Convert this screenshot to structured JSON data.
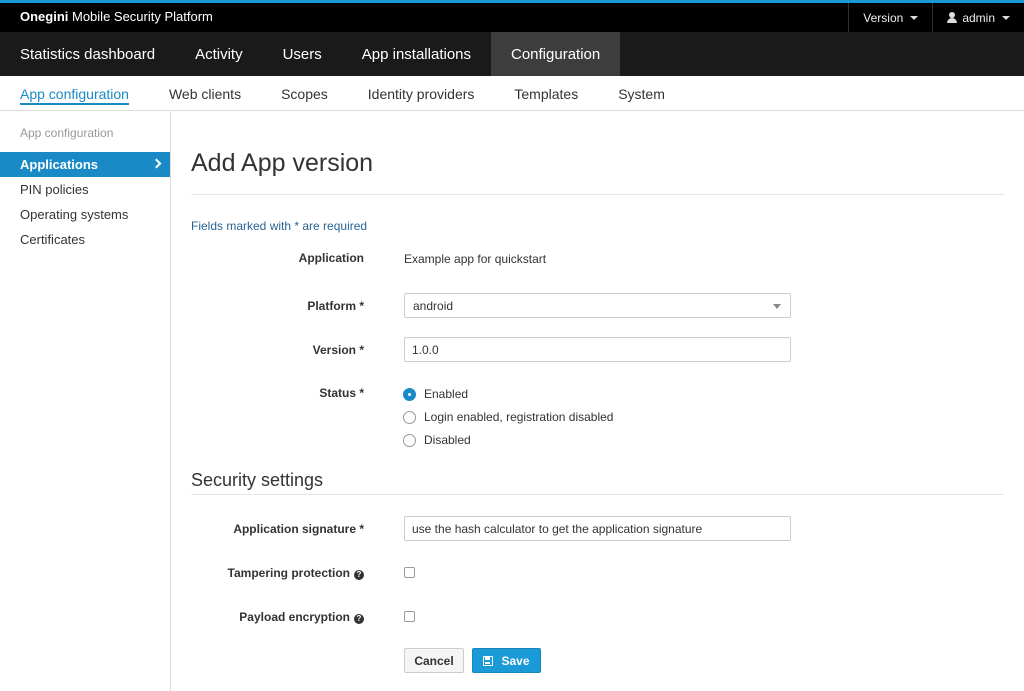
{
  "topbar": {
    "brand_bold": "Onegini",
    "brand_rest": " Mobile Security Platform",
    "version_label": "Version",
    "user_label": "admin"
  },
  "mainnav": [
    {
      "label": "Statistics dashboard",
      "active": false
    },
    {
      "label": "Activity",
      "active": false
    },
    {
      "label": "Users",
      "active": false
    },
    {
      "label": "App installations",
      "active": false
    },
    {
      "label": "Configuration",
      "active": true
    }
  ],
  "subnav": [
    {
      "label": "App configuration",
      "active": true
    },
    {
      "label": "Web clients",
      "active": false
    },
    {
      "label": "Scopes",
      "active": false
    },
    {
      "label": "Identity providers",
      "active": false
    },
    {
      "label": "Templates",
      "active": false
    },
    {
      "label": "System",
      "active": false
    }
  ],
  "sidebar": {
    "heading": "App configuration",
    "items": [
      {
        "label": "Applications",
        "active": true
      },
      {
        "label": "PIN policies",
        "active": false
      },
      {
        "label": "Operating systems",
        "active": false
      },
      {
        "label": "Certificates",
        "active": false
      }
    ]
  },
  "form": {
    "title": "Add App version",
    "required_note": "Fields marked with * are required",
    "application_label": "Application",
    "application_value": "Example app for quickstart",
    "platform_label": "Platform *",
    "platform_value": "android",
    "version_label": "Version *",
    "version_value": "1.0.0",
    "status_label": "Status *",
    "status_options": [
      {
        "label": "Enabled",
        "checked": true
      },
      {
        "label": "Login enabled, registration disabled",
        "checked": false
      },
      {
        "label": "Disabled",
        "checked": false
      }
    ],
    "security_title": "Security settings",
    "signature_label": "Application signature *",
    "signature_value": "use the hash calculator to get the application signature",
    "tampering_label": "Tampering protection",
    "tampering_checked": false,
    "payload_label": "Payload encryption",
    "payload_checked": false,
    "help_glyph": "?",
    "cancel_label": "Cancel",
    "save_label": "Save"
  },
  "colors": {
    "accent": "#1a8ac6",
    "topbar": "#000000",
    "mainnav": "#1a1a1a",
    "mainnav_active": "#3d3d3d"
  }
}
